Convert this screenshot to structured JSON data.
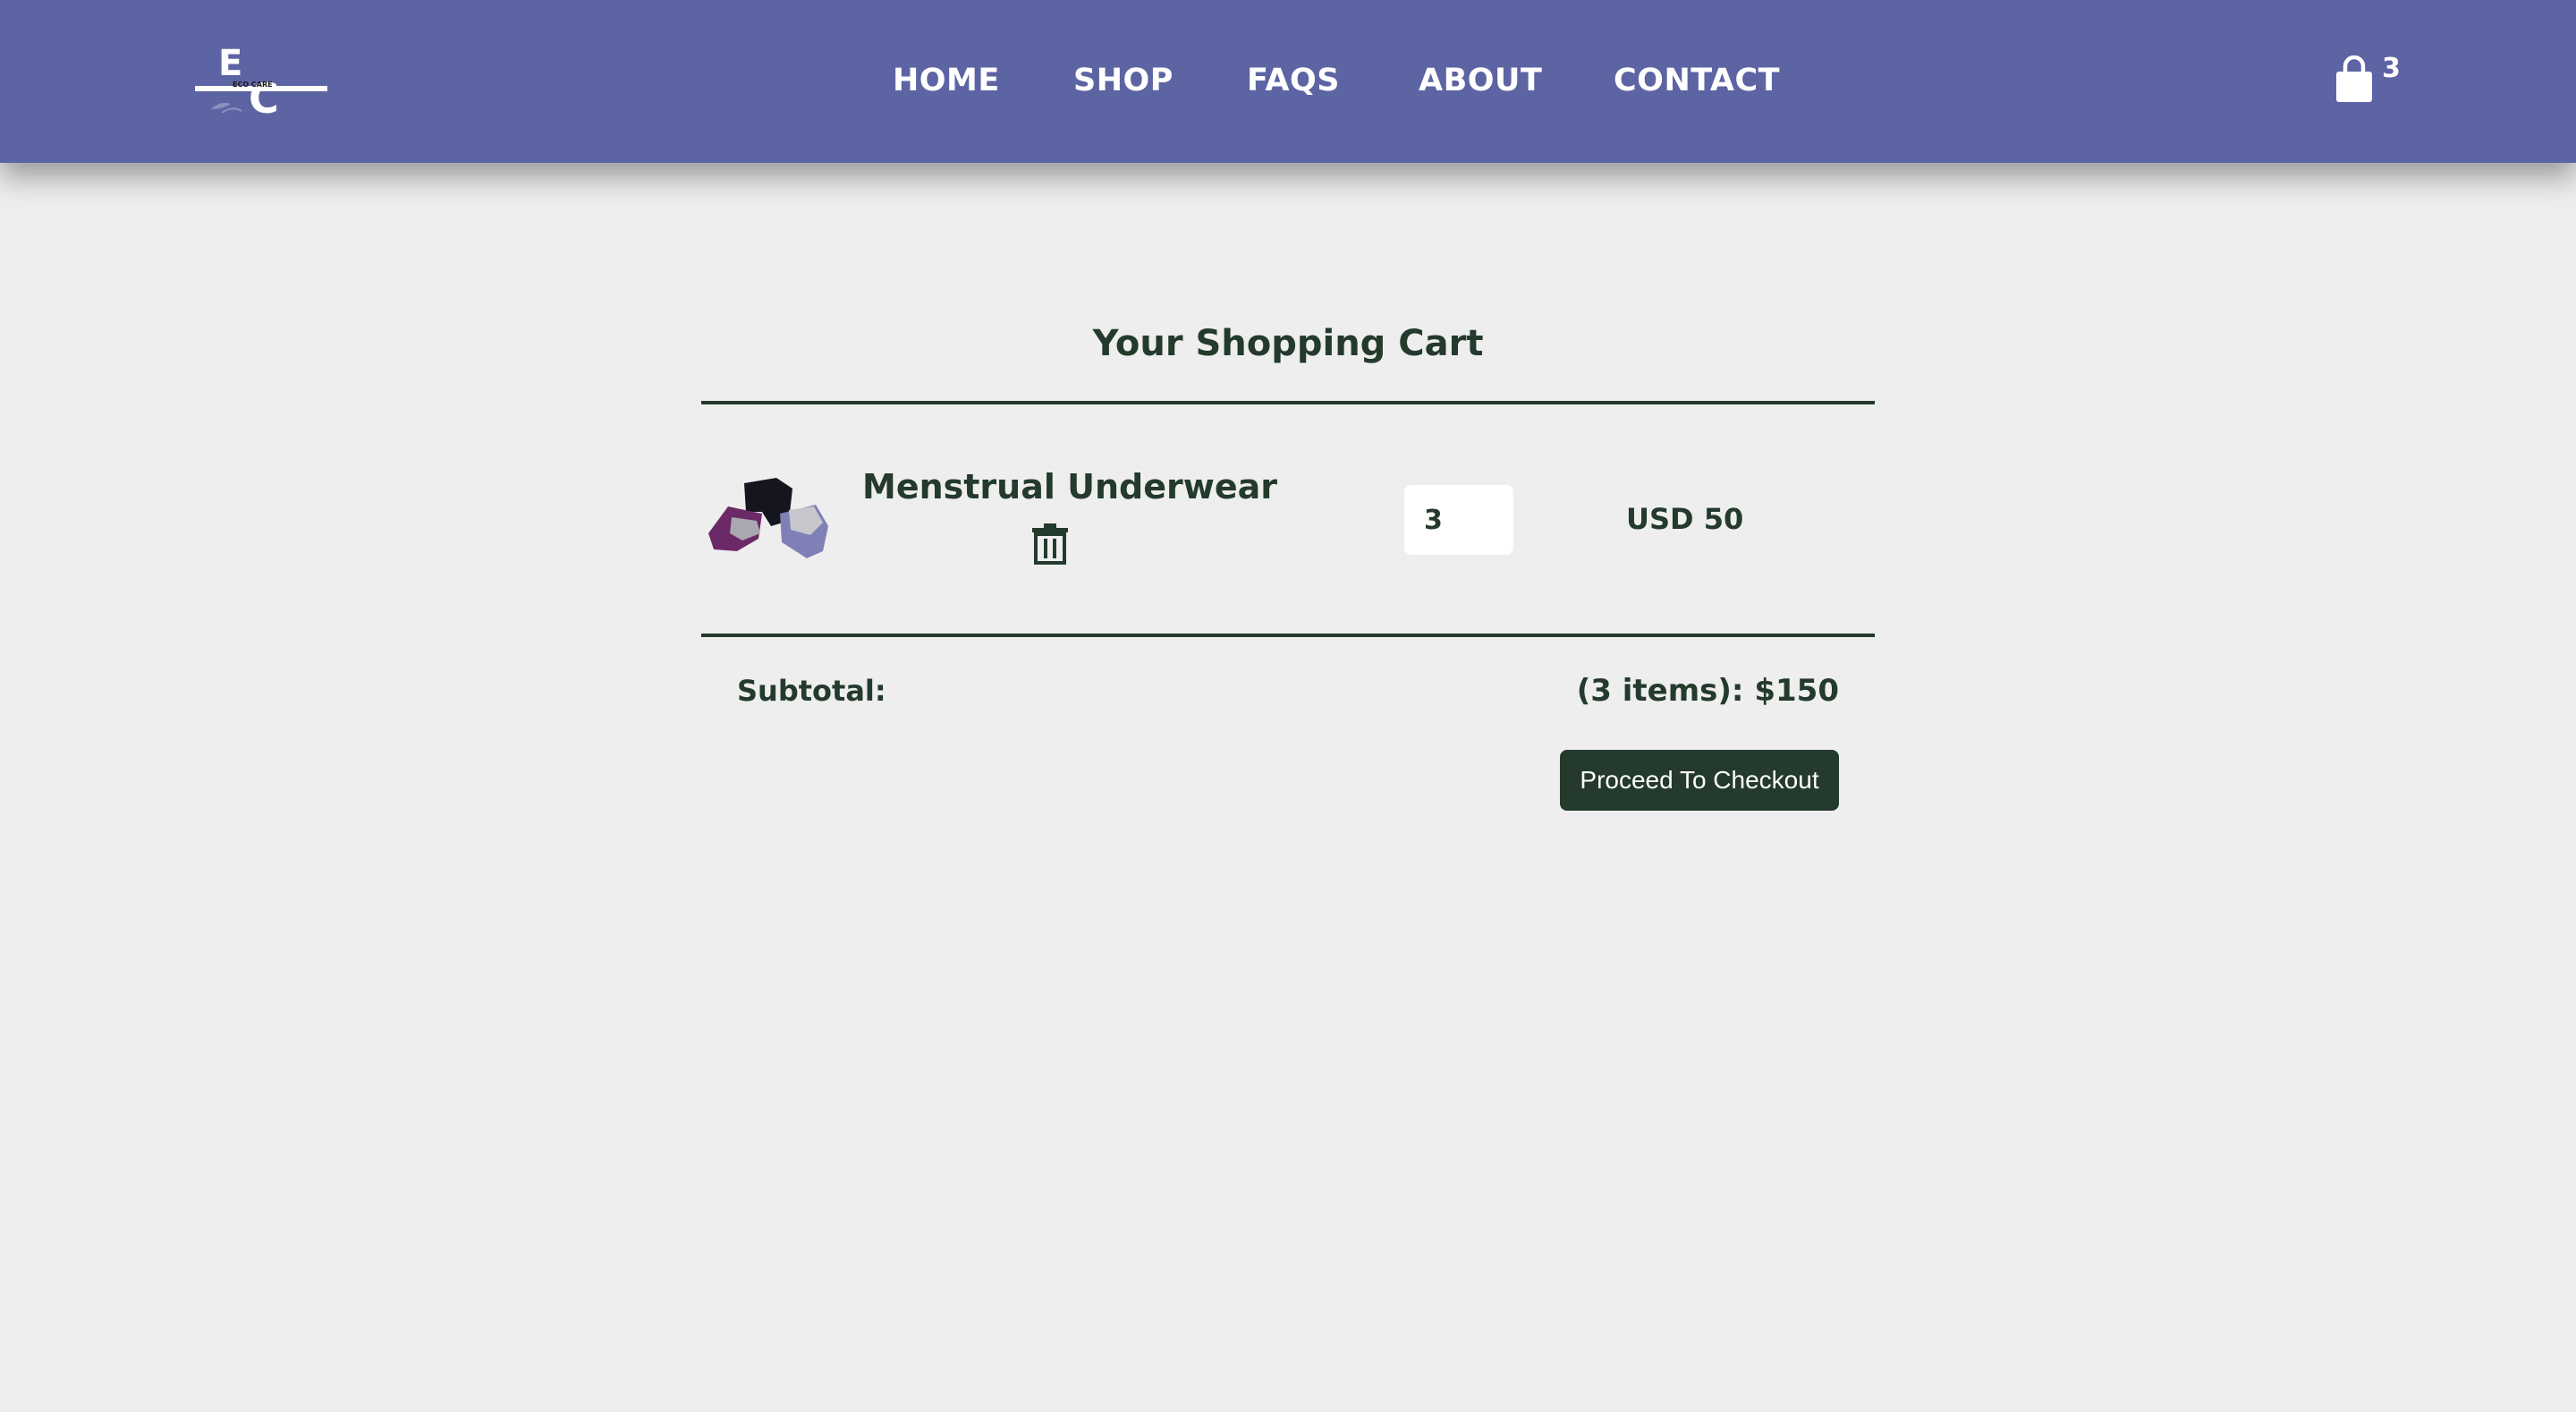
{
  "header": {
    "logo": {
      "letters": [
        "E",
        "C"
      ],
      "text": "ECO CARE"
    },
    "nav": [
      {
        "label": "HOME"
      },
      {
        "label": "SHOP"
      },
      {
        "label": "FAQS"
      },
      {
        "label": "ABOUT"
      },
      {
        "label": "CONTACT"
      }
    ],
    "cart": {
      "icon": "shopping-bag-icon",
      "count": "3"
    }
  },
  "cart": {
    "title": "Your Shopping Cart",
    "items": [
      {
        "name": "Menstrual Underwear",
        "quantity": "3",
        "price": "USD 50",
        "remove_icon": "trash-icon"
      }
    ],
    "subtotal_label": "Subtotal:",
    "subtotal_value": "(3 items): $150",
    "checkout_label": "Proceed To Checkout"
  },
  "colors": {
    "navbar": "#5d64a3",
    "background": "#eeeeee",
    "accent_dark_green": "#233a2c",
    "white": "#ffffff"
  }
}
